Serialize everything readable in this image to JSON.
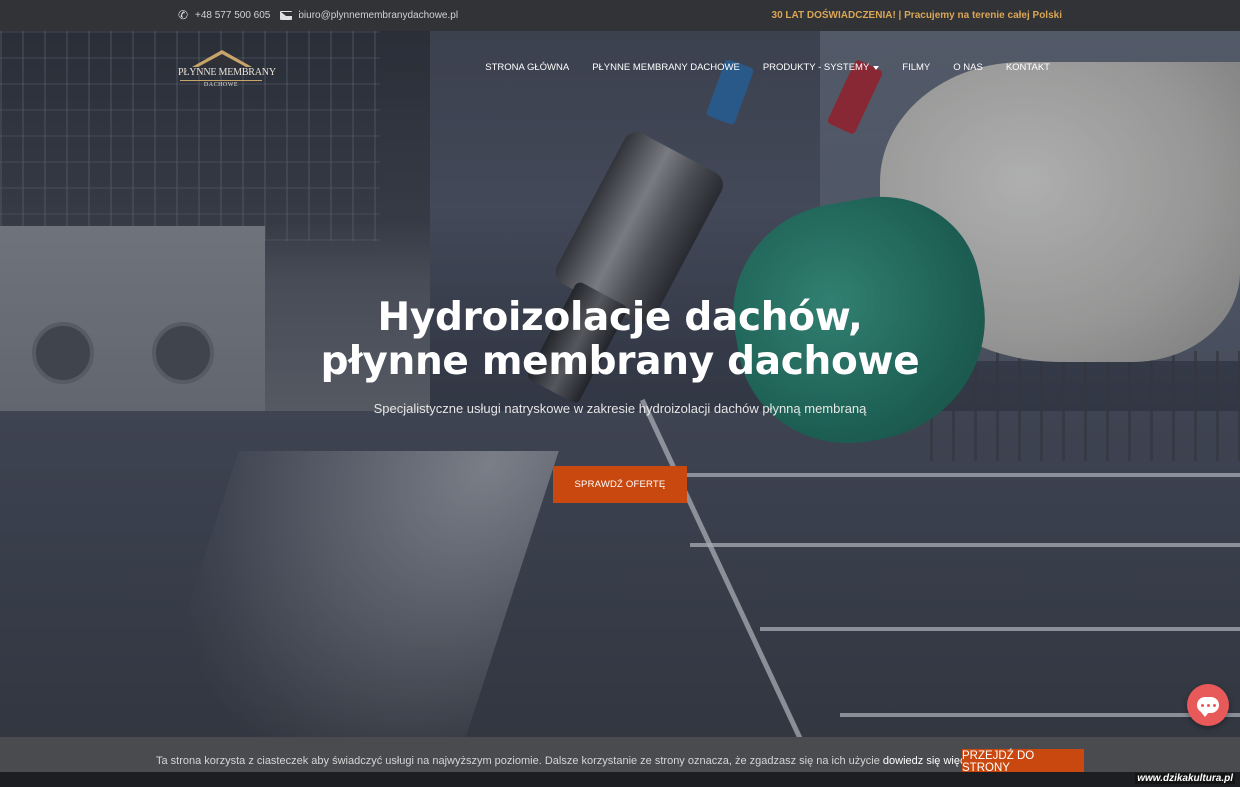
{
  "topbar": {
    "phone": "+48 577 500 605",
    "email": "biuro@plynnemembranydachowe.pl",
    "promo": "30 LAT DOŚWIADCZENIA! | Pracujemy na terenie całej Polski",
    "phone_icon": "phone-icon",
    "email_icon": "envelope-icon"
  },
  "logo": {
    "name": "PŁYNNE MEMBRANY",
    "sub": "DACHOWE"
  },
  "nav": {
    "items": [
      {
        "label": "STRONA GŁÓWNA"
      },
      {
        "label": "PŁYNNE MEMBRANY DACHOWE"
      },
      {
        "label": "PRODUKTY - SYSTEMY",
        "has_dropdown": true
      },
      {
        "label": "FILMY"
      },
      {
        "label": "O NAS"
      },
      {
        "label": "KONTAKT"
      }
    ]
  },
  "hero": {
    "title_line1": "Hydroizolacje dachów,",
    "title_line2": "płynne membrany dachowe",
    "subtitle": "Specjalistyczne usługi natryskowe w zakresie hydroizolacji dachów płynną membraną",
    "cta_label": "SPRAWDŹ OFERTĘ"
  },
  "chat": {
    "icon": "chat-bubble-icon"
  },
  "cookie": {
    "text": "Ta strona korzysta z ciasteczek aby świadczyć usługi na najwyższym poziomie. Dalsze korzystanie ze strony oznacza, że zgadzasz się na ich użycie ",
    "more_link": "dowiedz się więcej.",
    "button_label": "PRZEJDŹ DO STRONY"
  },
  "watermark": "www.dzikakultura.pl",
  "colors": {
    "accent": "#c9480f",
    "promo": "#d9a656",
    "topbar": "#323337",
    "chat": "#e85a5a"
  }
}
